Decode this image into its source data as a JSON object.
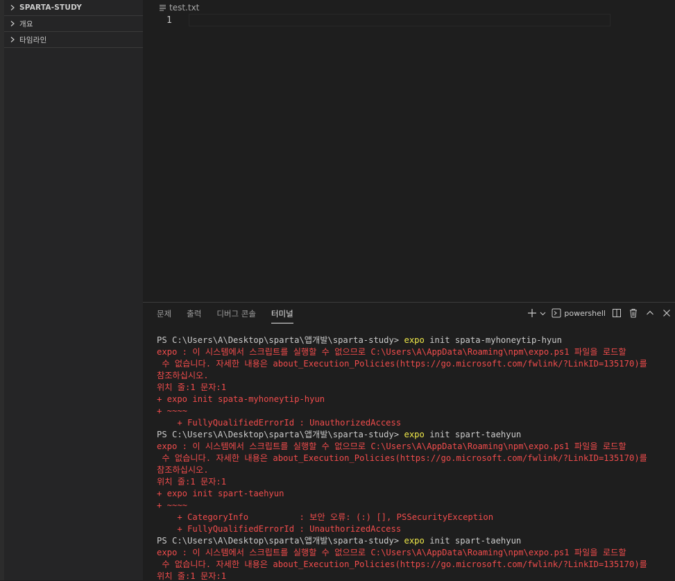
{
  "sidebar": {
    "sections": [
      {
        "label": "SPARTA-STUDY"
      },
      {
        "label": "개요"
      },
      {
        "label": "타임라인"
      }
    ]
  },
  "editor": {
    "tab_file": "test.txt",
    "line_number": "1"
  },
  "panel": {
    "tabs": [
      {
        "label": "문제"
      },
      {
        "label": "출력"
      },
      {
        "label": "디버그 콘솔"
      },
      {
        "label": "터미널"
      }
    ],
    "active_tab": "터미널",
    "shell": "powershell"
  },
  "terminal": {
    "lines": [
      {
        "segs": [
          {
            "t": "PS C:\\Users\\A\\Desktop\\sparta\\앱개발\\sparta-study> ",
            "c": "w"
          },
          {
            "t": "expo",
            "c": "y"
          },
          {
            "t": " init spata-myhoneytip-hyun",
            "c": "w"
          }
        ]
      },
      {
        "segs": [
          {
            "t": "expo : 이 시스템에서 스크립트를 실행할 수 없으므로 C:\\Users\\A\\AppData\\Roaming\\npm\\expo.ps1 파일을 로드할",
            "c": "r"
          }
        ]
      },
      {
        "segs": [
          {
            "t": " 수 없습니다. 자세한 내용은 about_Execution_Policies(https://go.microsoft.com/fwlink/?LinkID=135170)를",
            "c": "r"
          }
        ]
      },
      {
        "segs": [
          {
            "t": "참조하십시오.",
            "c": "r"
          }
        ]
      },
      {
        "segs": [
          {
            "t": "위치 줄:1 문자:1",
            "c": "r"
          }
        ]
      },
      {
        "segs": [
          {
            "t": "+ expo init spata-myhoneytip-hyun",
            "c": "r"
          }
        ]
      },
      {
        "segs": [
          {
            "t": "+ ~~~~",
            "c": "r"
          }
        ]
      },
      {
        "segs": [
          {
            "t": "    + FullyQualifiedErrorId : UnauthorizedAccess",
            "c": "r"
          }
        ]
      },
      {
        "segs": [
          {
            "t": "PS C:\\Users\\A\\Desktop\\sparta\\앱개발\\sparta-study> ",
            "c": "w"
          },
          {
            "t": "expo",
            "c": "y"
          },
          {
            "t": " init spart-taehyun",
            "c": "w"
          }
        ]
      },
      {
        "segs": [
          {
            "t": "expo : 이 시스템에서 스크립트를 실행할 수 없으므로 C:\\Users\\A\\AppData\\Roaming\\npm\\expo.ps1 파일을 로드할",
            "c": "r"
          }
        ]
      },
      {
        "segs": [
          {
            "t": " 수 없습니다. 자세한 내용은 about_Execution_Policies(https://go.microsoft.com/fwlink/?LinkID=135170)를",
            "c": "r"
          }
        ]
      },
      {
        "segs": [
          {
            "t": "참조하십시오.",
            "c": "r"
          }
        ]
      },
      {
        "segs": [
          {
            "t": "위치 줄:1 문자:1",
            "c": "r"
          }
        ]
      },
      {
        "segs": [
          {
            "t": "+ expo init spart-taehyun",
            "c": "r"
          }
        ]
      },
      {
        "segs": [
          {
            "t": "+ ~~~~",
            "c": "r"
          }
        ]
      },
      {
        "segs": [
          {
            "t": "    + CategoryInfo          : 보안 오류: (:) [], PSSecurityException",
            "c": "r"
          }
        ]
      },
      {
        "segs": [
          {
            "t": "    + FullyQualifiedErrorId : UnauthorizedAccess",
            "c": "r"
          }
        ]
      },
      {
        "segs": [
          {
            "t": "PS C:\\Users\\A\\Desktop\\sparta\\앱개발\\sparta-study> ",
            "c": "w"
          },
          {
            "t": "expo",
            "c": "y"
          },
          {
            "t": " init spart-taehyun",
            "c": "w"
          }
        ]
      },
      {
        "segs": [
          {
            "t": "expo : 이 시스템에서 스크립트를 실행할 수 없으므로 C:\\Users\\A\\AppData\\Roaming\\npm\\expo.ps1 파일을 로드할",
            "c": "r"
          }
        ]
      },
      {
        "segs": [
          {
            "t": " 수 없습니다. 자세한 내용은 about_Execution_Policies(https://go.microsoft.com/fwlink/?LinkID=135170)를",
            "c": "r"
          }
        ]
      },
      {
        "segs": [
          {
            "t": "위치 줄:1 문자:1",
            "c": "r"
          }
        ]
      }
    ]
  },
  "colors": {
    "background": "#1e1e1e",
    "sidebar": "#252526",
    "error": "#f14c4c",
    "command": "#f0e94a",
    "text": "#cccccc"
  },
  "icons": {
    "chevron": "chevron-right-icon",
    "file": "file-text-icon",
    "add": "plus-icon",
    "dropdown": "chevron-down-icon",
    "terminal": "terminal-icon",
    "split": "split-icon",
    "trash": "trash-icon",
    "maximize": "chevron-up-icon",
    "close": "close-icon"
  }
}
